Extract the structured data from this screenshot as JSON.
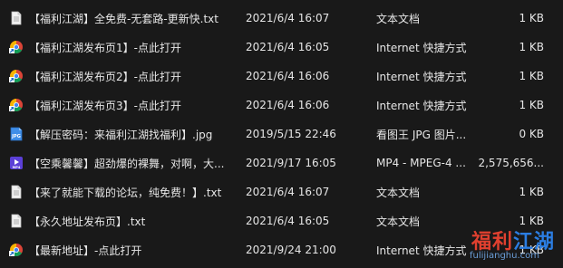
{
  "files": [
    {
      "icon": "text-file-icon",
      "name": "【福利江湖】全免费-无套路-更新快.txt",
      "date": "2021/6/4 16:07",
      "type": "文本文档",
      "size": "1 KB"
    },
    {
      "icon": "internet-shortcut-icon",
      "name": "【福利江湖发布页1】-点此打开",
      "date": "2021/6/4 16:05",
      "type": "Internet 快捷方式",
      "size": "1 KB"
    },
    {
      "icon": "internet-shortcut-icon",
      "name": "【福利江湖发布页2】-点此打开",
      "date": "2021/6/4 16:06",
      "type": "Internet 快捷方式",
      "size": "1 KB"
    },
    {
      "icon": "internet-shortcut-icon",
      "name": "【福利江湖发布页3】-点此打开",
      "date": "2021/6/4 16:06",
      "type": "Internet 快捷方式",
      "size": "1 KB"
    },
    {
      "icon": "jpg-image-icon",
      "name": "【解压密码：来福利江湖找福利】.jpg",
      "date": "2019/5/15 22:46",
      "type": "看图王 JPG 图片...",
      "size": "0 KB"
    },
    {
      "icon": "mp4-video-icon",
      "name": "【空乘馨馨】超劲爆的裸舞，对啊，大...",
      "date": "2021/9/17 16:05",
      "type": "MP4 - MPEG-4 ...",
      "size": "2,575,656..."
    },
    {
      "icon": "text-file-icon",
      "name": "【来了就能下载的论坛，纯免费！】.txt",
      "date": "2021/6/4 16:07",
      "type": "文本文档",
      "size": "1 KB"
    },
    {
      "icon": "text-file-icon",
      "name": "【永久地址发布页】.txt",
      "date": "2021/6/4 16:05",
      "type": "文本文档",
      "size": "1 KB"
    },
    {
      "icon": "internet-shortcut-icon",
      "name": "【最新地址】-点此打开",
      "date": "2021/9/24 21:00",
      "type": "Internet 快捷方式",
      "size": "1 KB"
    }
  ],
  "watermark": {
    "brand_part1": "福利",
    "brand_part2": "江湖",
    "domain": "fulijianghu.com"
  },
  "colors": {
    "background": "#191919",
    "text": "#e6e6e6",
    "watermark_red": "#e0402f",
    "watermark_blue": "#2b7de1"
  }
}
